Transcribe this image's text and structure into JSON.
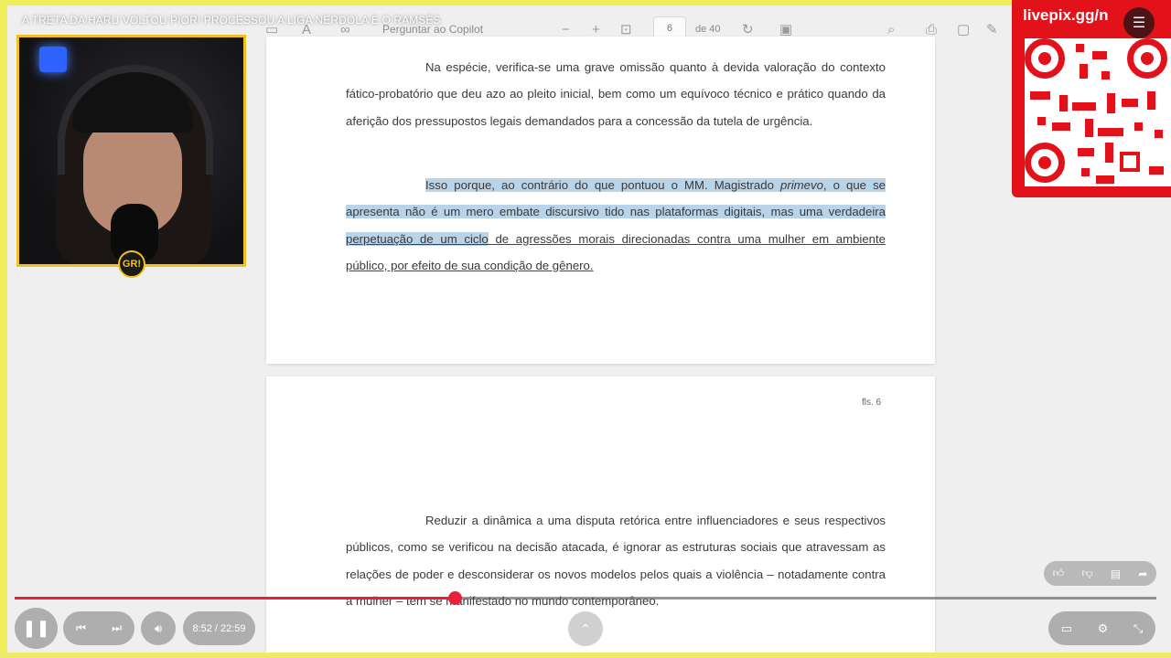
{
  "video": {
    "title": "A TRETA DA HARU VOLTOU PIOR! PROCESSOU A LIGA NERDOLA E O RAMSÉS",
    "time_display": "8:52 / 22:59",
    "progress": 0.386
  },
  "stream_overlay": {
    "qr_label": "livepix.gg/n"
  },
  "pdf_toolbar": {
    "copilot_label": "Perguntar ao Copilot",
    "page_current": "6",
    "page_total_label": "de 40"
  },
  "document": {
    "page1": {
      "paragraph1": "Na espécie, verifica-se uma grave omissão quanto à devida valoração do contexto fático-probatório que deu azo ao pleito inicial, bem como um equívoco técnico e prático quando da aferição dos pressupostos legais demandados para a concessão da tutela de urgência.",
      "p2_highlight_a": "Isso porque, ao contrário do que pontuou o MM. Magistrado ",
      "p2_italic": "primevo",
      "p2_highlight_b": ", o que se apresenta não é um mero embate discursivo tido nas plataformas digitais, mas uma verdadeira ",
      "p2_highlight_ul": "perpetuação de um ciclo",
      "p2_underlined": " de agressões morais direcionadas contra uma mulher em ambiente público, por efeito de sua condição de gênero."
    },
    "page2": {
      "page_number": "fls. 6",
      "paragraph1": "Reduzir a dinâmica a uma disputa retórica entre influenciadores e seus respectivos públicos, como se verificou na decisão atacada, é ignorar as estruturas sociais que atravessam as relações de poder e desconsiderar os novos modelos pelos quais a violência – notadamente contra a mulher – tem se manifestado no mundo contemporâneo."
    }
  },
  "webcam": {
    "logo_text": "GR!"
  },
  "colors": {
    "accent_red": "#e8203a",
    "frame_yellow": "#f1ee5c",
    "highlight_blue": "#b9d3e8",
    "qr_red": "#e3121a"
  }
}
